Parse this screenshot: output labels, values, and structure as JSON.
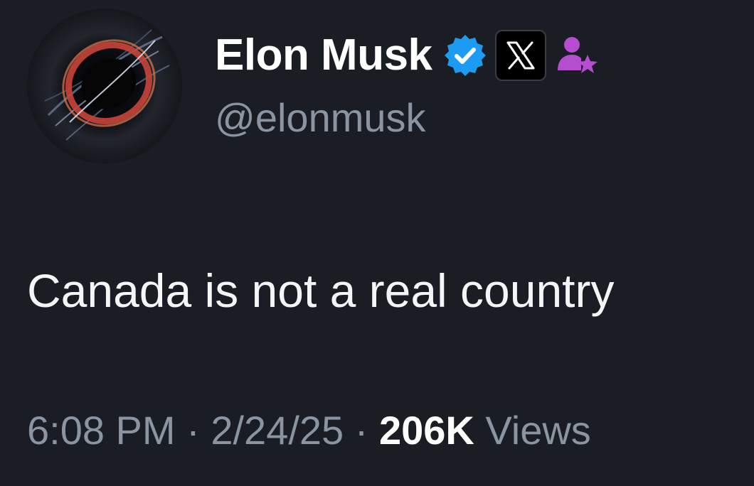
{
  "user": {
    "display_name": "Elon Musk",
    "handle": "@elonmusk",
    "verified_badge_color": "#1d9bf0",
    "affiliate_badge_icon": "x-logo-icon",
    "role_icon": "person-star-icon",
    "role_icon_color": "#b54dce",
    "avatar_icon": "black-hole-avatar"
  },
  "tweet": {
    "text": "Canada is not a real country",
    "time": "6:08 PM",
    "separator_1": "·",
    "date": "2/24/25",
    "separator_2": "·",
    "views_count": "206K",
    "views_label": "Views"
  },
  "colors": {
    "background": "#1a1d24",
    "primary_text": "#ffffff",
    "secondary_text": "#8b95a1"
  }
}
